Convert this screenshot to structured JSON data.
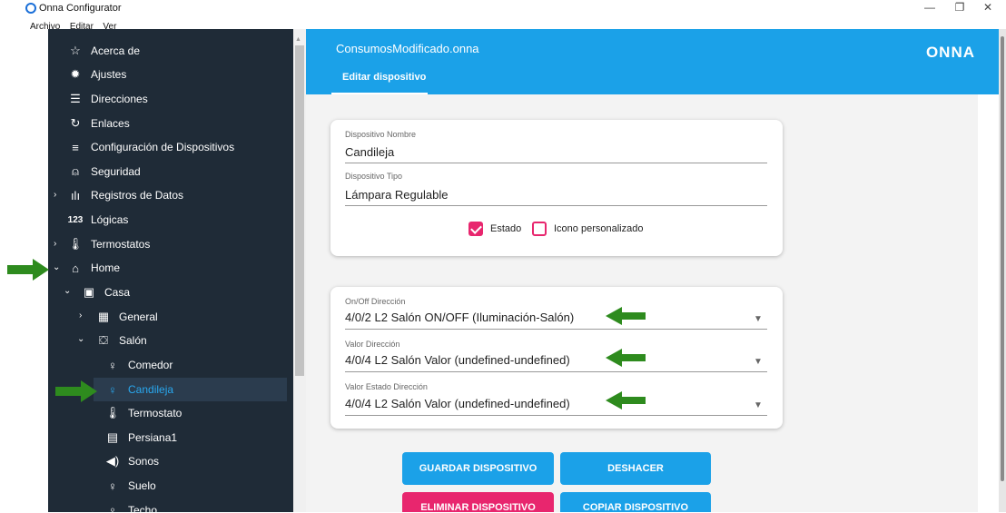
{
  "window": {
    "title": "Onna Configurator",
    "minimize": "—",
    "maximize": "❐",
    "close": "✕"
  },
  "menu": [
    "Archivo",
    "Editar",
    "Ver"
  ],
  "sidebar": {
    "items": [
      {
        "label": "Acerca de",
        "icon": "star-outline-icon"
      },
      {
        "label": "Ajustes",
        "icon": "gear-icon"
      },
      {
        "label": "Direcciones",
        "icon": "list-icon"
      },
      {
        "label": "Enlaces",
        "icon": "refresh-icon"
      },
      {
        "label": "Configuración de Dispositivos",
        "icon": "edit-list-icon"
      },
      {
        "label": "Seguridad",
        "icon": "alarm-icon"
      },
      {
        "label": "Registros de Datos",
        "icon": "chart-icon"
      },
      {
        "label": "Lógicas",
        "icon": "numeric-icon"
      },
      {
        "label": "Termostatos",
        "icon": "thermometer-icon"
      },
      {
        "label": "Home",
        "icon": "home-icon"
      },
      {
        "label": "Casa",
        "icon": "floorplan-icon"
      },
      {
        "label": "General",
        "icon": "room-icon"
      },
      {
        "label": "Salón",
        "icon": "sofa-icon"
      },
      {
        "label": "Comedor",
        "icon": "bulb-icon"
      },
      {
        "label": "Candileja",
        "icon": "bulb-icon"
      },
      {
        "label": "Termostato",
        "icon": "thermometer-icon"
      },
      {
        "label": "Persiana1",
        "icon": "blind-icon"
      },
      {
        "label": "Sonos",
        "icon": "speaker-icon"
      },
      {
        "label": "Suelo",
        "icon": "bulb-icon"
      },
      {
        "label": "Techo",
        "icon": "bulb-icon"
      }
    ],
    "selected": "Candileja"
  },
  "header": {
    "file": "ConsumosModificado.onna",
    "logo": "ONNA",
    "tab": "Editar dispositivo"
  },
  "device": {
    "name_label": "Dispositivo Nombre",
    "name_value": "Candileja",
    "type_label": "Dispositivo Tipo",
    "type_value": "Lámpara Regulable",
    "estado_label": "Estado",
    "estado_checked": true,
    "icono_label": "Icono personalizado",
    "icono_checked": false
  },
  "addresses": {
    "onoff_label": "On/Off Dirección",
    "onoff_value": "4/0/2 L2 Salón ON/OFF (Iluminación-Salón)",
    "valor_label": "Valor Dirección",
    "valor_value": "4/0/4 L2 Salón Valor (undefined-undefined)",
    "estado_label": "Valor Estado Dirección",
    "estado_value": "4/0/4 L2 Salón Valor (undefined-undefined)"
  },
  "buttons": {
    "save": "GUARDAR DISPOSITIVO",
    "undo": "DESHACER",
    "delete": "ELIMINAR DISPOSITIVO",
    "copy": "COPIAR DISPOSITIVO"
  },
  "colors": {
    "accent": "#1ba1e8",
    "danger": "#e8266e",
    "sidebar": "#1f2b37",
    "arrow": "#2e8b1e"
  }
}
